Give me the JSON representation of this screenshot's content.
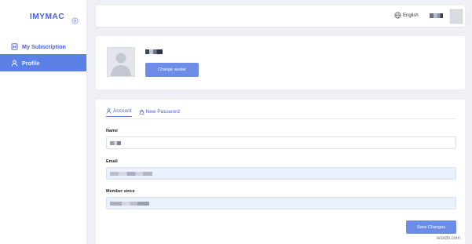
{
  "app": {
    "logo": "IMYMAC"
  },
  "sidebar": {
    "items": [
      {
        "label": "My Subscription",
        "icon": "subscription-icon",
        "active": false
      },
      {
        "label": "Profile",
        "icon": "user-icon",
        "active": true
      }
    ]
  },
  "topbar": {
    "language": "English",
    "language_icon": "globe-icon"
  },
  "profile": {
    "change_avatar_label": "Change avatar"
  },
  "tabs": [
    {
      "label": "Account",
      "icon": "user-icon",
      "active": true
    },
    {
      "label": "New Password",
      "icon": "lock-icon",
      "active": false
    }
  ],
  "form": {
    "name_label": "Name",
    "email_label": "Email",
    "member_since_label": "Member since",
    "save_label": "Save Changes"
  },
  "watermark": "wsxdn.com",
  "colors": {
    "accent": "#5b80e6",
    "button": "#6c8ce8",
    "logo": "#4a5fd8",
    "readonly_field": "#eaf0fd"
  }
}
